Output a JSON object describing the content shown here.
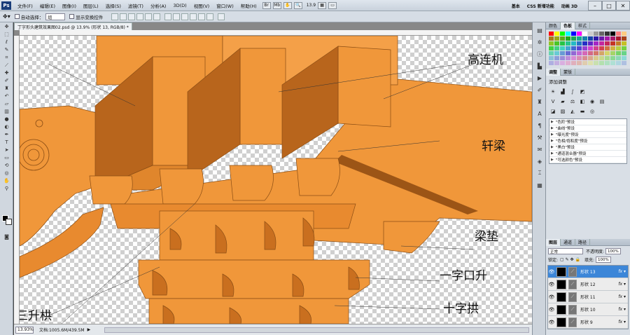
{
  "menubar": {
    "logo": "Ps",
    "items": [
      "文件(F)",
      "编辑(E)",
      "图像(I)",
      "图层(L)",
      "选择(S)",
      "滤镜(T)",
      "分析(A)",
      "3D(D)",
      "视图(V)",
      "窗口(W)",
      "帮助(H)"
    ],
    "zoom": "13.9",
    "workspace": [
      "基本",
      "CSS 新增功能",
      "动画 3D"
    ]
  },
  "options": {
    "auto_select_label": "自动选择：",
    "auto_select_value": "组",
    "transform_label": "显示变换控件"
  },
  "document": {
    "tab_title": "丁字形头建筑效果图02.psd @ 13.9% (形状 13, RGB/8) *"
  },
  "canvas": {
    "labels": [
      "高连机",
      "轩梁",
      "梁垫",
      "一字口升",
      "十字拱",
      "三升栱"
    ]
  },
  "status": {
    "zoom": "13.93%",
    "doc_info": "文档:1005.6M/439.5M"
  },
  "panels": {
    "tabs_top": [
      "颜色",
      "色板",
      "样式"
    ],
    "adjust_tabs": [
      "调整",
      "蒙版"
    ],
    "adjust_title": "添加调整",
    "presets": [
      "\"色阶\"预设",
      "\"曲线\"预设",
      "\"曝光度\"预设",
      "\"色相/饱和度\"预设",
      "\"黑白\"预设",
      "\"通道混合器\"预设",
      "\"可选颜色\"预设"
    ],
    "layer_tabs": [
      "图层",
      "通道",
      "路径"
    ],
    "blend_mode": "正常",
    "opacity_label": "不透明度:",
    "opacity": "100%",
    "lock_label": "锁定:",
    "fill_label": "填充:",
    "fill": "100%",
    "layers": [
      {
        "name": "形状 13",
        "selected": true
      },
      {
        "name": "形状 12"
      },
      {
        "name": "形状 11"
      },
      {
        "name": "形状 10"
      },
      {
        "name": "形状 9"
      }
    ]
  },
  "colors": {
    "wood": "#f0973a",
    "wood_dark": "#c96f1f",
    "wood_shadow": "#8a4d14",
    "selection": "#3c86d8"
  }
}
